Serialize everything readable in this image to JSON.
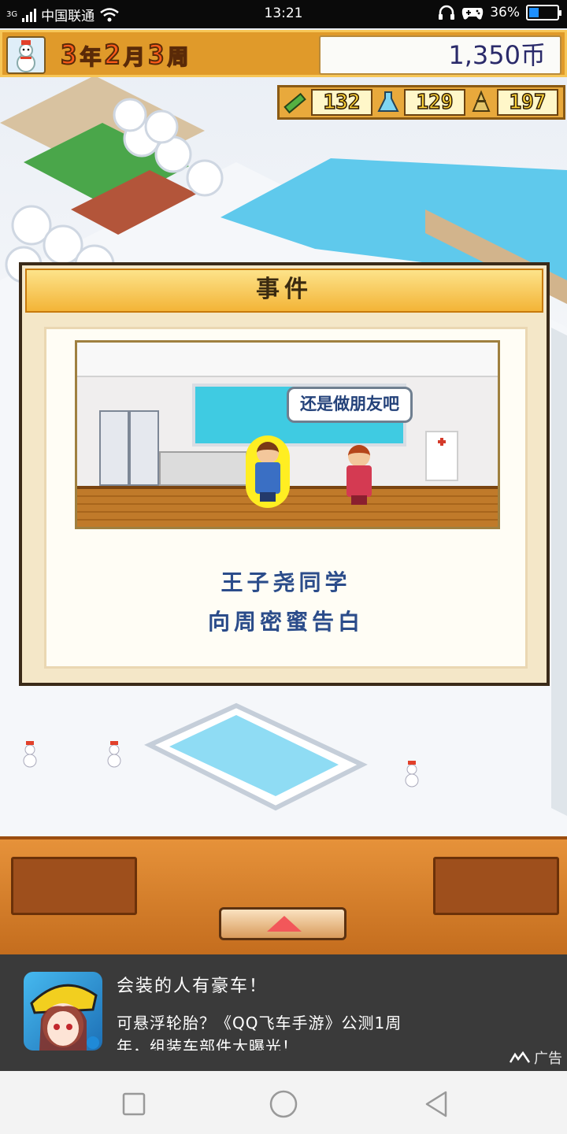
{
  "status_bar": {
    "network": "3G",
    "carrier": "中国联通",
    "time": "13:21",
    "battery": "36%",
    "battery_level": 0.36
  },
  "hud": {
    "year_num": "3",
    "year_unit": "年",
    "month_num": "2",
    "month_unit": "月",
    "week_num": "3",
    "week_unit": "周",
    "money": "1,350币",
    "stats": [
      {
        "icon": "pencil-icon",
        "value": "132"
      },
      {
        "icon": "flask-icon",
        "value": "129"
      },
      {
        "icon": "bell-icon",
        "value": "197"
      }
    ]
  },
  "event_dialog": {
    "title": "事件",
    "speech_bubble": "还是做朋友吧",
    "line1": "王子尧同学",
    "line2": "向周密蜜告白"
  },
  "ad": {
    "title": "会装的人有豪车！",
    "text": "可悬浮轮胎？《QQ飞车手游》公测1周年，组装车部件大曝光！",
    "label": "广告"
  },
  "colors": {
    "hud_orange": "#e09a2a",
    "date_digit": "#ff5b1a",
    "event_text": "#2b4c8a",
    "ad_bg": "#3a3a3a"
  }
}
